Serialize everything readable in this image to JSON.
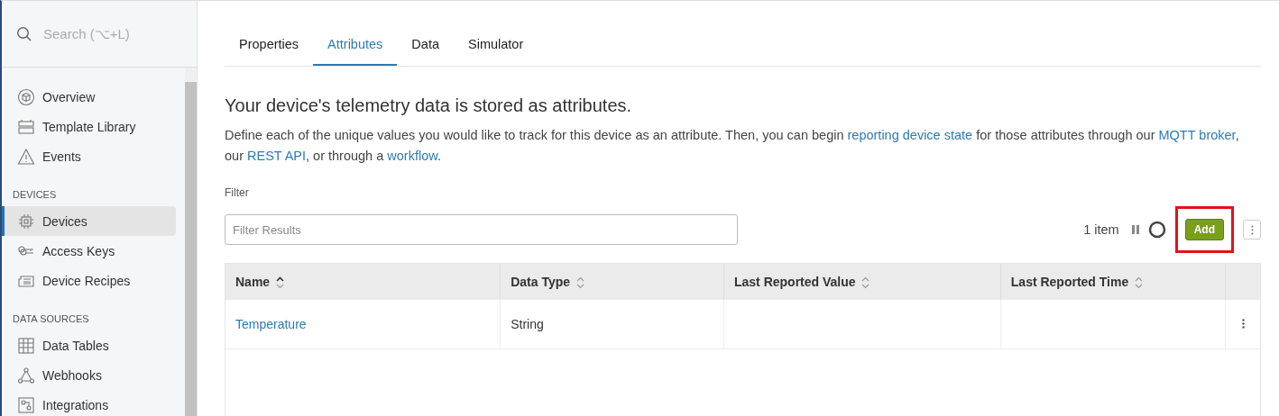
{
  "sidebar": {
    "search": {
      "placeholder": "Search (⌥+L)"
    },
    "sections": [
      {
        "items": [
          {
            "label": "Overview",
            "selected": false
          },
          {
            "label": "Template Library",
            "selected": false
          },
          {
            "label": "Events",
            "selected": false
          }
        ]
      },
      {
        "heading": "DEVICES",
        "items": [
          {
            "label": "Devices",
            "selected": true
          },
          {
            "label": "Access Keys",
            "selected": false
          },
          {
            "label": "Device Recipes",
            "selected": false
          }
        ]
      },
      {
        "heading": "DATA SOURCES",
        "items": [
          {
            "label": "Data Tables",
            "selected": false
          },
          {
            "label": "Webhooks",
            "selected": false
          },
          {
            "label": "Integrations",
            "selected": false
          }
        ]
      }
    ]
  },
  "tabs": [
    {
      "label": "Properties",
      "selected": false
    },
    {
      "label": "Attributes",
      "selected": true
    },
    {
      "label": "Data",
      "selected": false
    },
    {
      "label": "Simulator",
      "selected": false
    }
  ],
  "heading": "Your device's telemetry data is stored as attributes.",
  "description": [
    {
      "text": "Define each of the unique values you would like to track for this device as an attribute. Then, you can begin ",
      "link": false
    },
    {
      "text": "reporting device state",
      "link": true
    },
    {
      "text": " for those attributes through our ",
      "link": false
    },
    {
      "text": "MQTT broker",
      "link": true
    },
    {
      "text": ", our ",
      "link": false
    },
    {
      "text": "REST API",
      "link": true
    },
    {
      "text": ", or through a ",
      "link": false
    },
    {
      "text": "workflow",
      "link": true
    },
    {
      "text": ".",
      "link": false
    }
  ],
  "filter": {
    "label": "Filter",
    "placeholder": "Filter Results"
  },
  "item_count": "1 item",
  "add_button": {
    "label": "Add",
    "highlighted": true
  },
  "table": {
    "columns": [
      {
        "label": "Name",
        "sorted": true
      },
      {
        "label": "Data Type",
        "sorted": false
      },
      {
        "label": "Last Reported Value",
        "sorted": false
      },
      {
        "label": "Last Reported Time",
        "sorted": false
      }
    ],
    "rows": [
      {
        "name": "Temperature",
        "data_type": "String"
      }
    ]
  }
}
